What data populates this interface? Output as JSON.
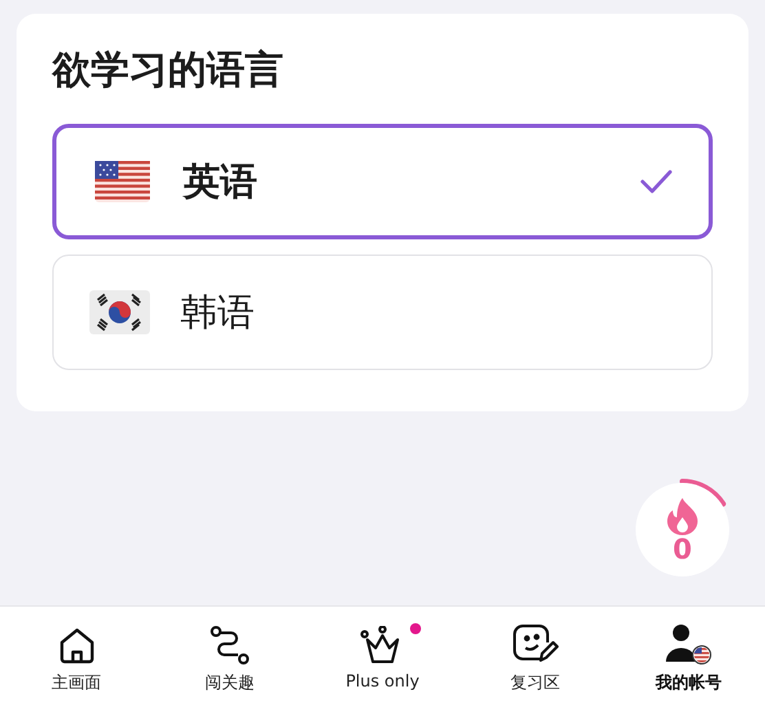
{
  "card": {
    "title": "欲学习的语言",
    "languages": [
      {
        "kind": "us",
        "label": "英语",
        "selected": true
      },
      {
        "kind": "kr",
        "label": "韩语",
        "selected": false
      }
    ]
  },
  "streak": {
    "count": "0",
    "level": 0.16
  },
  "nav": [
    {
      "kind": "home",
      "label": "主画面",
      "selected": false,
      "notification": false
    },
    {
      "kind": "path",
      "label": "闯关趣",
      "selected": false,
      "notification": false
    },
    {
      "kind": "crown",
      "label": "Plus only",
      "selected": false,
      "notification": true
    },
    {
      "kind": "review",
      "label": "复习区",
      "selected": false,
      "notification": false
    },
    {
      "kind": "account",
      "label": "我的帐号",
      "selected": true,
      "notification": false
    }
  ]
}
